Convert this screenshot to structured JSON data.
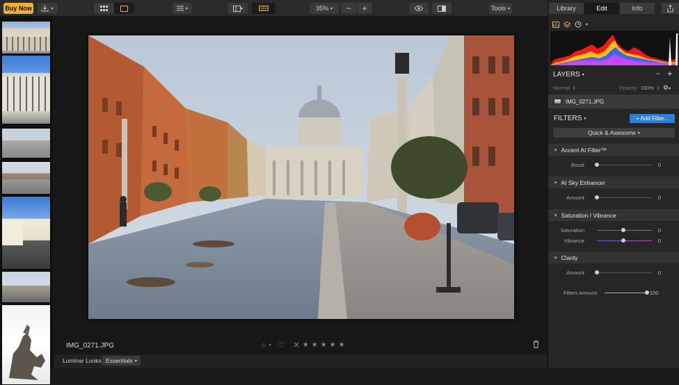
{
  "toolbar": {
    "buy_now": "Buy Now",
    "zoom": "35%",
    "zoom_minus": "−",
    "zoom_plus": "+",
    "tools": "Tools"
  },
  "canvas": {
    "filename": "IMG_0271.JPG",
    "looks_label": "Luminar Looks:",
    "looks_value": "Essentials"
  },
  "panel": {
    "tabs": [
      {
        "label": "Library"
      },
      {
        "label": "Edit"
      },
      {
        "label": "Info"
      }
    ],
    "layers": {
      "title": "LAYERS",
      "blend_mode": "Normal",
      "opacity_label": "Opacity:",
      "opacity_value": "100%",
      "layer_name": "IMG_0271.JPG"
    },
    "filters": {
      "title": "FILTERS",
      "add_button": "+ Add Filter...",
      "preset": "Quick & Awesome",
      "groups": [
        {
          "name": "Accent AI Filter™",
          "sliders": [
            {
              "label": "Boost",
              "value": "0",
              "level": 0
            }
          ]
        },
        {
          "name": "AI Sky Enhancer",
          "sliders": [
            {
              "label": "Amount",
              "value": "0",
              "level": 0
            }
          ]
        },
        {
          "name": "Saturation / Vibrance",
          "sliders": [
            {
              "label": "Saturation",
              "value": "0",
              "level": 0.5
            },
            {
              "label": "Vibrance",
              "value": "0",
              "level": 0.5
            }
          ]
        },
        {
          "name": "Clarity",
          "sliders": [
            {
              "label": "Amount",
              "value": "0",
              "level": 0
            }
          ]
        }
      ],
      "filters_amount_label": "Filters Amount",
      "filters_amount_value": "100",
      "filters_amount_level": 1
    }
  },
  "colors": {
    "accent": "#2a7fd8",
    "buy_now_bg": "#f0ad2e",
    "amount_slider": "#e8a23a"
  }
}
